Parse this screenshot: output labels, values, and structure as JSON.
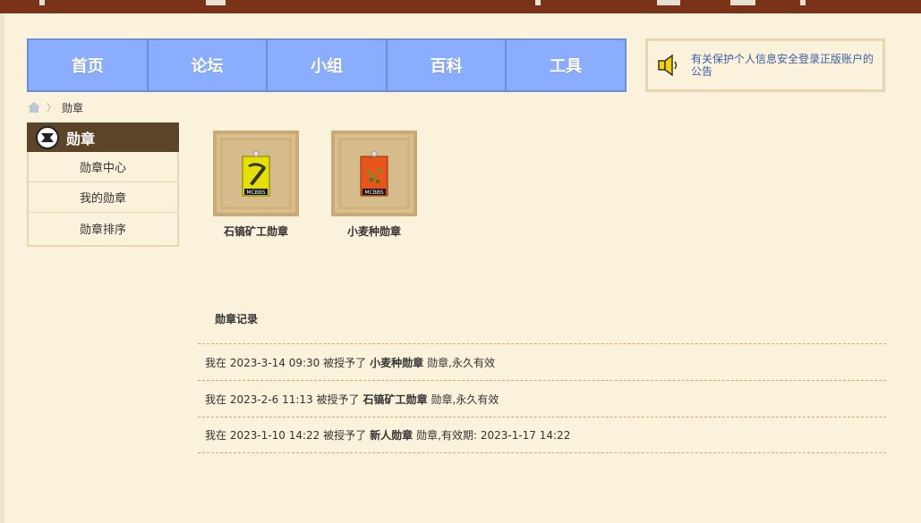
{
  "nav": {
    "items": [
      {
        "label": "首页"
      },
      {
        "label": "论坛"
      },
      {
        "label": "小组"
      },
      {
        "label": "百科"
      },
      {
        "label": "工具"
      }
    ]
  },
  "notice": {
    "text": "有关保护个人信息安全登录正版账户的公告",
    "icon": "speaker-icon"
  },
  "breadcrumb": {
    "home_icon": "home-icon",
    "separator": "〉",
    "current": "勋章"
  },
  "sidebar": {
    "title": "勋章",
    "icon": "medal-icon",
    "items": [
      {
        "label": "勋章中心"
      },
      {
        "label": "我的勋章"
      },
      {
        "label": "勋章排序"
      }
    ]
  },
  "badges": [
    {
      "name": "石镐矿工勋章",
      "tag": "MCBBS",
      "color": "#e6e000",
      "icon": "pickaxe-icon"
    },
    {
      "name": "小麦种勋章",
      "tag": "MCBBS",
      "color": "#e8541a",
      "icon": "wheat-seeds-icon"
    }
  ],
  "records": {
    "title": "勋章记录",
    "rows": [
      {
        "prefix": "我在 2023-3-14 09:30 被授予了",
        "badge": "小麦种勋章",
        "suffix": "勋章,永久有效"
      },
      {
        "prefix": "我在 2023-2-6 11:13 被授予了",
        "badge": "石镐矿工勋章",
        "suffix": "勋章,永久有效"
      },
      {
        "prefix": "我在 2023-1-10 14:22 被授予了",
        "badge": "新人勋章",
        "suffix": "勋章,有效期: 2023-1-17 14:22"
      }
    ]
  },
  "colors": {
    "nav_bg": "#8aadff",
    "top_bar": "#7a3318",
    "page_bg": "#fbf2dc",
    "notice_text": "#3b5fa6"
  }
}
